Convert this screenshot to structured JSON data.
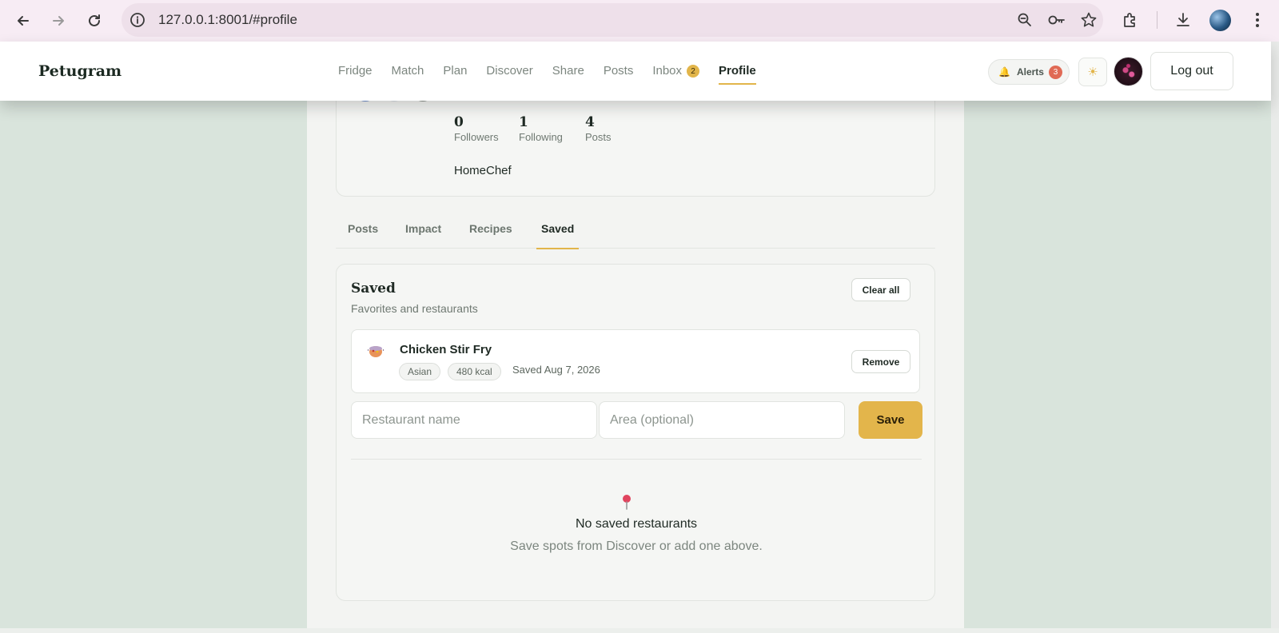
{
  "browser": {
    "url": "127.0.0.1:8001/#profile"
  },
  "app": {
    "brand": "Petugram",
    "nav": [
      {
        "label": "Fridge"
      },
      {
        "label": "Match"
      },
      {
        "label": "Plan"
      },
      {
        "label": "Discover"
      },
      {
        "label": "Share"
      },
      {
        "label": "Posts"
      },
      {
        "label": "Inbox",
        "badge": "2"
      },
      {
        "label": "Profile",
        "active": true
      }
    ],
    "alerts_label": "Alerts",
    "alerts_count": "3",
    "logout_label": "Log out",
    "colors": {
      "accent": "#e2b54a",
      "alert": "#e06a55"
    }
  },
  "profile": {
    "stats": [
      {
        "value": "0",
        "label": "Followers"
      },
      {
        "value": "1",
        "label": "Following"
      },
      {
        "value": "4",
        "label": "Posts"
      }
    ],
    "bio": "HomeChef"
  },
  "tabs": [
    {
      "label": "Posts"
    },
    {
      "label": "Impact"
    },
    {
      "label": "Recipes"
    },
    {
      "label": "Saved",
      "active": true
    }
  ],
  "saved": {
    "title": "Saved",
    "subtitle": "Favorites and restaurants",
    "clear_label": "Clear all",
    "recipe": {
      "icon": "cooking-pot-icon",
      "name": "Chicken Stir Fry",
      "tags": [
        "Asian",
        "480 kcal"
      ],
      "saved_date": "Saved Aug 7, 2026",
      "remove_label": "Remove"
    },
    "restaurant_placeholder": "Restaurant name",
    "area_placeholder": "Area (optional)",
    "save_label": "Save",
    "empty_title": "No saved restaurants",
    "empty_subtitle": "Save spots from Discover or add one above."
  }
}
